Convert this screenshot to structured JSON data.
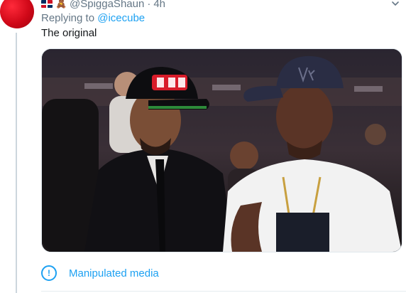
{
  "tweet": {
    "handle": "@SpiggaShaun",
    "separator": "·",
    "time": "4h",
    "reply_prefix": "Replying to ",
    "reply_mention": "@icecube",
    "text": "The original",
    "media_label": "Manipulated media",
    "media_icon": "!",
    "flag_icon": "dominican-republic-flag-icon",
    "emoji_icon": "teddy-bear-icon"
  },
  "colors": {
    "accent": "#1da1f2",
    "secondary_text": "#657786",
    "primary_text": "#14171a",
    "avatar": "#d00818"
  }
}
